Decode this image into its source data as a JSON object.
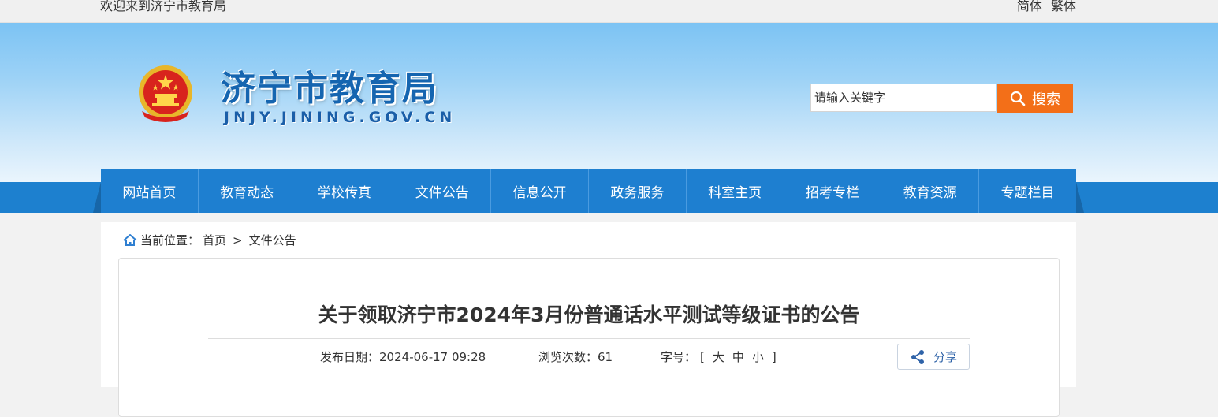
{
  "topbar": {
    "welcome": "欢迎来到济宁市教育局",
    "lang_simplified": "简体",
    "lang_traditional": "繁体"
  },
  "header": {
    "title": "济宁市教育局",
    "domain": "JNJY.JINING.GOV.CN",
    "emblem_icon": "national-emblem-icon"
  },
  "search": {
    "placeholder": "请输入关键字",
    "button_label": "搜索",
    "button_color": "#f36f18",
    "icon": "search-icon"
  },
  "nav": {
    "items": [
      {
        "label": "网站首页"
      },
      {
        "label": "教育动态"
      },
      {
        "label": "学校传真"
      },
      {
        "label": "文件公告"
      },
      {
        "label": "信息公开"
      },
      {
        "label": "政务服务"
      },
      {
        "label": "科室主页"
      },
      {
        "label": "招考专栏"
      },
      {
        "label": "教育资源"
      },
      {
        "label": "专题栏目"
      }
    ],
    "color": "#1e7fd0"
  },
  "breadcrumb": {
    "prefix": "当前位置：",
    "home": "首页",
    "separator": ">",
    "current": "文件公告",
    "icon": "home-icon"
  },
  "article": {
    "title": "关于领取济宁市2024年3月份普通话水平测试等级证书的公告",
    "publish_label": "发布日期：",
    "publish_date": "2024-06-17 09:28",
    "views_label": "浏览次数：",
    "views": "61",
    "font_size_label": "字号：",
    "font_open": "[",
    "font_large": "大",
    "font_medium": "中",
    "font_small": "小",
    "font_close": "]",
    "share_label": "分享",
    "share_icon": "share-icon"
  }
}
